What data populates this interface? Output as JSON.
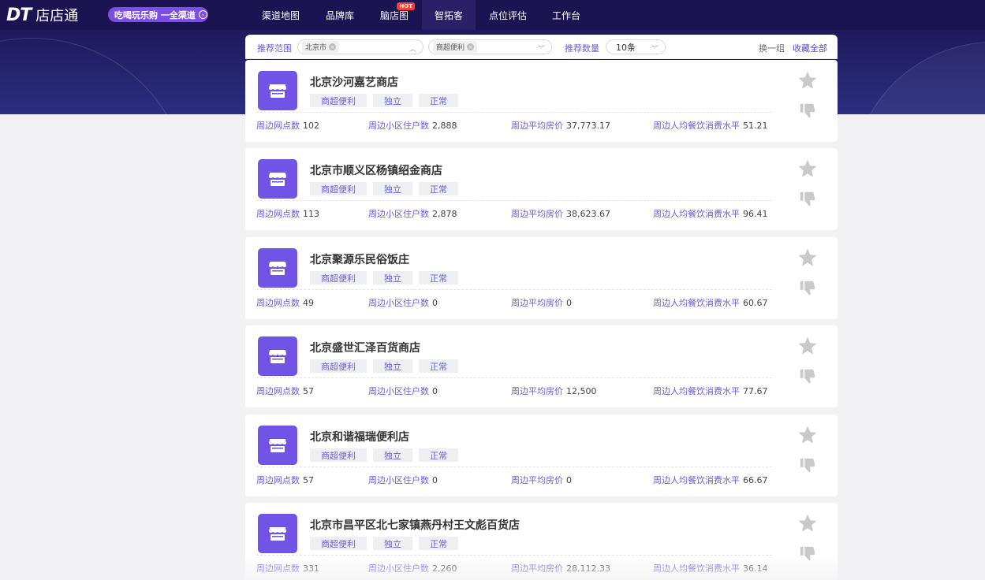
{
  "nav": {
    "brand": "店店通",
    "promo": "吃喝玩乐购 一全渠道",
    "hot_badge": "HOT",
    "items": [
      {
        "label": "渠道地图"
      },
      {
        "label": "品牌库"
      },
      {
        "label": "脑店图"
      },
      {
        "label": "智拓客"
      },
      {
        "label": "点位评估"
      },
      {
        "label": "工作台"
      }
    ],
    "active_index": 3
  },
  "filters": {
    "range_label": "推荐范围",
    "city_chip": "北京市",
    "category_chip": "商超便利",
    "count_label": "推荐数量",
    "count_value": "10条",
    "refresh": "换一组",
    "collect_all": "收藏全部"
  },
  "stat_labels": {
    "outlets": "周边网点数",
    "households": "周边小区住户数",
    "house_price": "周边平均房价",
    "dining": "周边人均餐饮消费水平"
  },
  "stores": [
    {
      "name": "北京沙河嘉艺商店",
      "tags": [
        "商超便利",
        "独立",
        "正常"
      ],
      "outlets": "102",
      "households": "2,888",
      "house_price": "37,773.17",
      "dining": "51.21"
    },
    {
      "name": "北京市顺义区杨镇绍金商店",
      "tags": [
        "商超便利",
        "独立",
        "正常"
      ],
      "outlets": "113",
      "households": "2,878",
      "house_price": "38,623.67",
      "dining": "96.41"
    },
    {
      "name": "北京聚源乐民俗饭庄",
      "tags": [
        "商超便利",
        "独立",
        "正常"
      ],
      "outlets": "49",
      "households": "0",
      "house_price": "0",
      "dining": "60.67"
    },
    {
      "name": "北京盛世汇泽百货商店",
      "tags": [
        "商超便利",
        "独立",
        "正常"
      ],
      "outlets": "57",
      "households": "0",
      "house_price": "12,500",
      "dining": "77.67"
    },
    {
      "name": "北京和谐福瑞便利店",
      "tags": [
        "商超便利",
        "独立",
        "正常"
      ],
      "outlets": "57",
      "households": "0",
      "house_price": "0",
      "dining": "66.67"
    },
    {
      "name": "北京市昌平区北七家镇燕丹村王文彪百货店",
      "tags": [
        "商超便利",
        "独立",
        "正常"
      ],
      "outlets": "331",
      "households": "2,260",
      "house_price": "28,112.33",
      "dining": "36.14"
    }
  ],
  "colors": {
    "nav_bg": "#1c1352",
    "accent": "#6b5ce7",
    "icon_bg": "#7154e6",
    "promo": "#7b4ee8"
  }
}
